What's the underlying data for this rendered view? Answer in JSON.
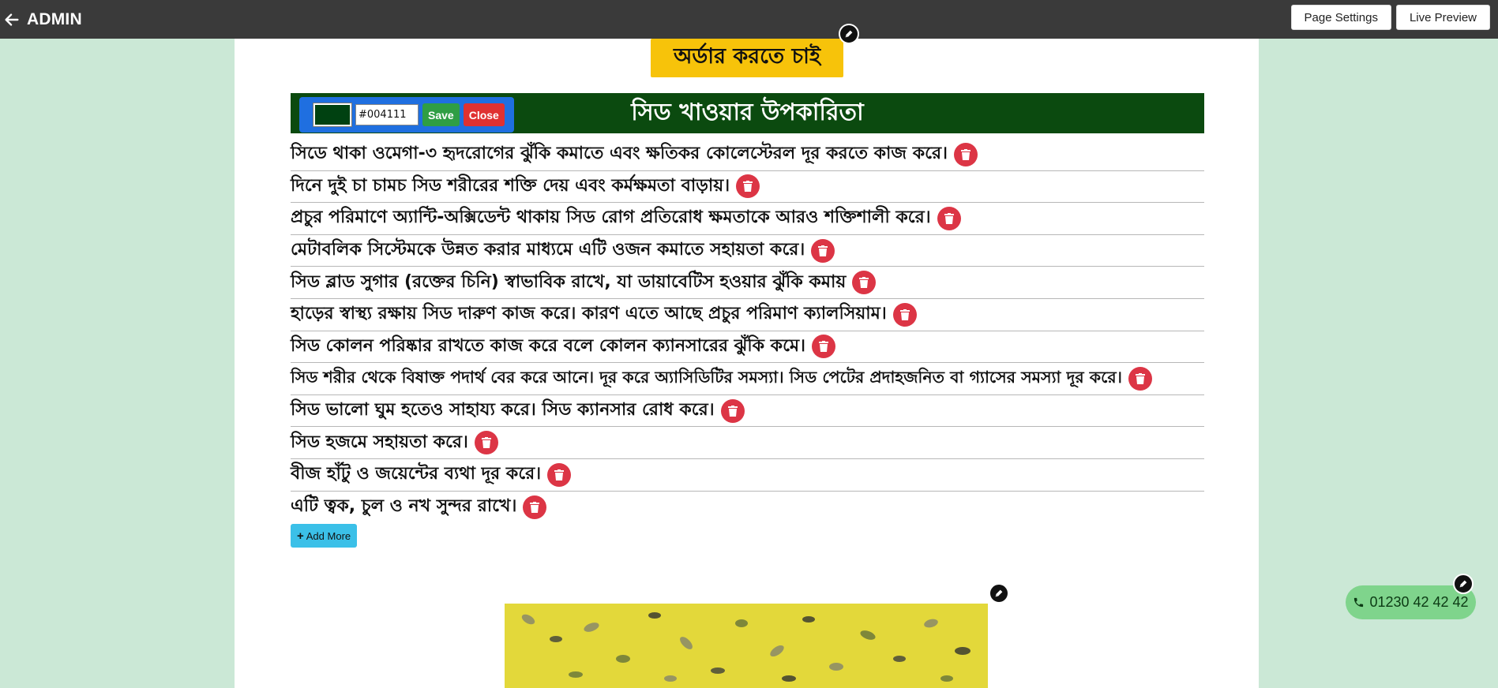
{
  "topbar": {
    "title": "ADMIN",
    "back_icon": "arrow-left-icon",
    "page_settings_label": "Page Settings",
    "live_preview_label": "Live Preview"
  },
  "order_button": {
    "label": "অর্ডার করতে চাই"
  },
  "section": {
    "title": "সিড খাওয়ার উপকারিতা",
    "background_color": "#004111"
  },
  "color_editor": {
    "hex_value": "#004111",
    "save_label": "Save",
    "close_label": "Close",
    "accent": "#1f6fe0"
  },
  "benefits": [
    "সিডে থাকা ওমেগা-৩ হৃদরোগের ঝুঁকি কমাতে এবং ক্ষতিকর কোলেস্টেরল দূর করতে কাজ করে।",
    "দিনে দুই চা চামচ সিড শরীরের শক্তি দেয় এবং কর্মক্ষমতা বাড়ায়।",
    "প্রচুর পরিমাণে অ্যান্টি-অক্সিডেন্ট থাকায় সিড রোগ প্রতিরোধ ক্ষমতাকে আরও শক্তিশালী করে।",
    "মেটাবলিক সিস্টেমকে উন্নত করার মাধ্যমে এটি ওজন কমাতে সহায়তা করে।",
    "সিড ব্লাড সুগার (রক্তের চিনি) স্বাভাবিক রাখে, যা ডায়াবেটিস হওয়ার ঝুঁকি কমায়",
    "হাড়ের স্বাস্থ্য রক্ষায় সিড দারুণ কাজ করে। কারণ এতে আছে প্রচুর পরিমাণ ক্যালসিয়াম।",
    "সিড কোলন পরিষ্কার রাখতে কাজ করে বলে কোলন ক্যানসারের ঝুঁকি কমে।",
    "সিড শরীর থেকে বিষাক্ত পদার্থ বের করে আনে। দূর করে অ্যাসিডিটির সমস্যা। সিড পেটের প্রদাহজনিত বা গ্যাসের সমস্যা দূর করে।",
    "সিড ভালো ঘুম হতেও সাহায্য করে। সিড ক্যানসার রোধ করে।",
    "সিড হজমে সহায়তা করে।",
    "বীজ হাঁটু ও জয়েন্টের ব্যথা দূর করে।",
    "এটি ত্বক, চুল ও নখ সুন্দর রাখে।"
  ],
  "add_more": {
    "label": "Add More",
    "icon": "plus-icon"
  },
  "phone": {
    "number": "01230 42 42 42",
    "icon": "phone-icon"
  },
  "colors": {
    "page_bg": "#cbe8d6",
    "topbar_bg": "#3a3a3a",
    "order_btn": "#f7c30a",
    "delete_btn": "#dc3545",
    "add_more_btn": "#3bc0e8",
    "phone_pill": "#7fd48c"
  }
}
